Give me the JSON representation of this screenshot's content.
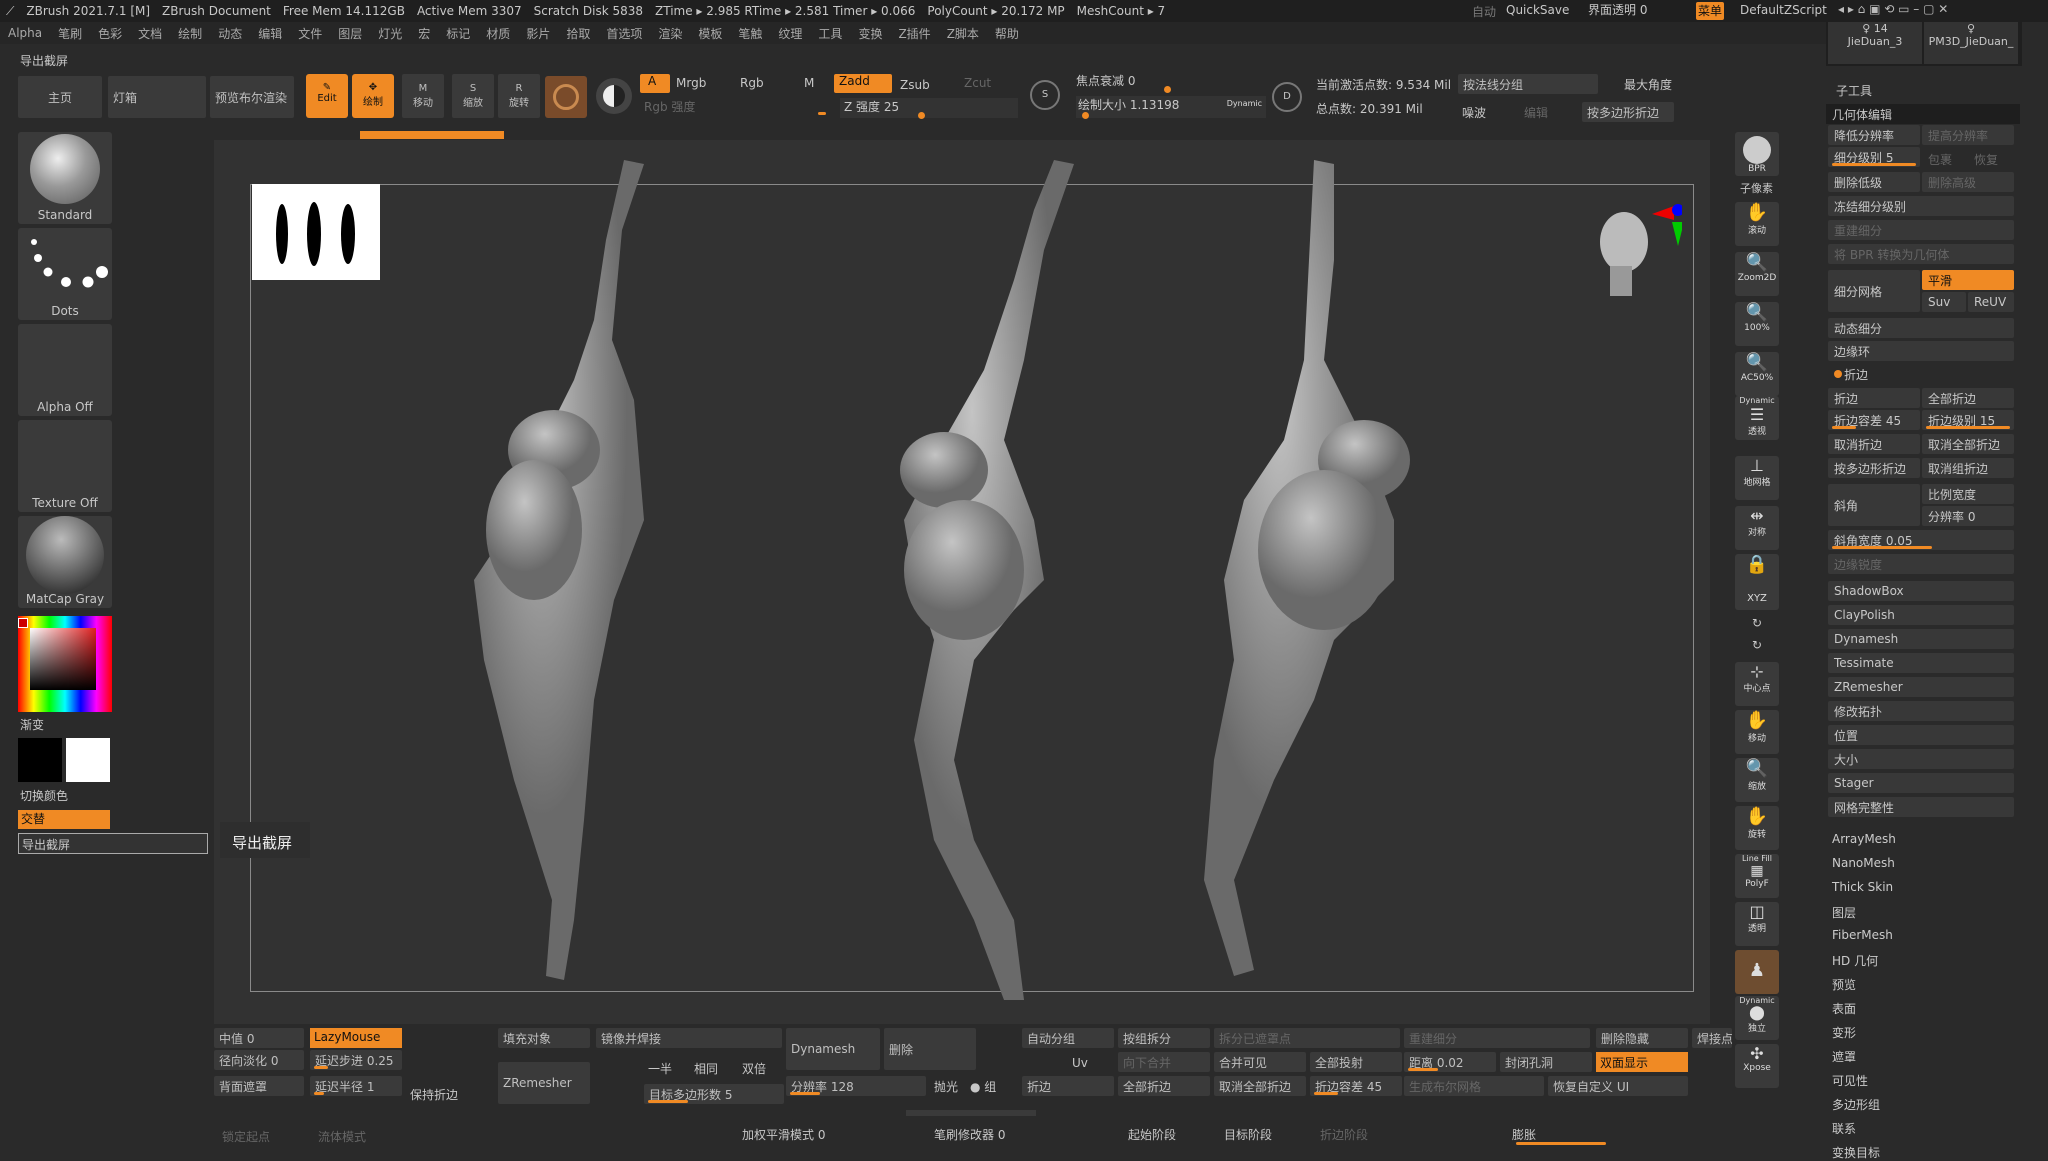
{
  "titlebar": {
    "app": "ZBrush 2021.7.1 [M]",
    "doc": "ZBrush Document",
    "free_mem": "Free Mem 14.112GB",
    "active_mem": "Active Mem 3307",
    "scratch": "Scratch Disk 5838",
    "ztime": "ZTime ▸ 2.985 RTime ▸ 2.581 Timer ▸ 0.066",
    "polycount": "PolyCount ▸ 20.172 MP",
    "meshcount": "MeshCount ▸ 7",
    "auto": "自动",
    "quicksave": "QuickSave",
    "ui_transparency": "界面透明 0",
    "menu_btn": "菜单",
    "script": "DefaultZScript",
    "tool_count": "14"
  },
  "menus": [
    "Alpha",
    "笔刷",
    "色彩",
    "文档",
    "绘制",
    "动态",
    "编辑",
    "文件",
    "图层",
    "灯光",
    "宏",
    "标记",
    "材质",
    "影片",
    "拾取",
    "首选项",
    "渲染",
    "模板",
    "笔触",
    "纹理",
    "工具",
    "变换",
    "Z插件",
    "Z脚本",
    "帮助"
  ],
  "export_label": "导出截屏",
  "top_tabs": {
    "home": "主页",
    "lightbox": "灯箱",
    "bpr": "预览布尔渲染"
  },
  "modes": {
    "edit": "Edit",
    "draw": "绘制",
    "move": "移动",
    "scale": "缩放",
    "rotate": "旋转"
  },
  "colors": {
    "accent": "#f08a24",
    "bg": "#2a2a2a",
    "canvas": "#333333"
  },
  "channels": {
    "a": "A",
    "mrgb": "Mrgb",
    "rgb": "Rgb",
    "m": "M",
    "rgb_intensity": "Rgb 强度",
    "zadd": "Zadd",
    "zsub": "Zsub",
    "zcut": "Zcut",
    "z_intensity": "Z 强度 25"
  },
  "brush_info": {
    "focal": "焦点衰减 0",
    "draw_size": "绘制大小 1.13198",
    "dynamic": "Dynamic",
    "active_points": "当前激活点数: 9.534 Mil",
    "total_points": "总点数: 20.391 Mil",
    "by_normal": "按法线分组",
    "max_angle": "最大角度",
    "noise": "噪波",
    "edit": "编辑",
    "by_poly_crease": "按多边形折边"
  },
  "left": {
    "brush": "Standard",
    "stroke": "Dots",
    "alpha": "Alpha Off",
    "texture": "Texture Off",
    "material": "MatCap Gray",
    "gradient": "渐变",
    "switch_color": "切换颜色",
    "alternate": "交替",
    "export": "导出截屏"
  },
  "canvas": {
    "tooltip": "导出截屏"
  },
  "right_tools": {
    "bpr": "BPR",
    "subpixel": "子像素",
    "scroll": "滚动",
    "zoom2d": "Zoom2D",
    "zoom100": "100%",
    "ac50": "AC50%",
    "persp": "透视",
    "floor": "地网格",
    "sym": "对称",
    "local": "",
    "xyz": "XYZ",
    "center": "中心点",
    "move": "移动",
    "zoom": "缩放",
    "rotate": "旋转",
    "linefill": "Line Fill",
    "polyf": "PolyF",
    "transp": "透明",
    "solo": "独立",
    "xpose": "Xpose"
  },
  "subtools": {
    "a": "JieDuan_3",
    "b": "PM3D_JieDuan_"
  },
  "panel": {
    "subtool": "子工具",
    "geometry": "几何体编辑",
    "lower_res": "降低分辨率",
    "higher_res": "提高分辨率",
    "sdiv": "细分级别 5",
    "cage": "包裹",
    "restore": "恢复",
    "del_lower": "删除低级",
    "del_higher": "删除高级",
    "freeze": "冻结细分级别",
    "reconstruct": "重建细分",
    "bpr_geo": "将 BPR 转换为几何体",
    "divide": "细分网格",
    "smooth": "平滑",
    "suv": "Suv",
    "reuv": "ReUV",
    "dyn_sub": "动态细分",
    "edgeloop": "边缘环",
    "crease": "折边",
    "crease2": "折边",
    "crease_all": "全部折边",
    "crease_tol": "折边容差 45",
    "crease_lvl": "折边级别 15",
    "uncrease": "取消折边",
    "uncrease_all": "取消全部折边",
    "by_poly_crease": "按多边形折边",
    "uncrease_group": "取消组折边",
    "bevel": "斜角",
    "ratio": "比例宽度",
    "res": "分辨率 0",
    "bevel_width": "斜角宽度 0.05",
    "edge_sharp": "边缘锐度",
    "shadowbox": "ShadowBox",
    "claypolish": "ClayPolish",
    "dynamesh": "Dynamesh",
    "tessimate": "Tessimate",
    "zremesher": "ZRemesher",
    "modtopo": "修改拓扑",
    "position": "位置",
    "size": "大小",
    "stager": "Stager",
    "meshintegrity": "网格完整性",
    "list": [
      "ArrayMesh",
      "NanoMesh",
      "Thick Skin",
      "图层",
      "FiberMesh",
      "HD 几何",
      "预览",
      "表面",
      "变形",
      "遮罩",
      "可见性",
      "多边形组",
      "联系",
      "变换目标"
    ]
  },
  "bottom": {
    "mid": "中值 0",
    "lazy": "LazyMouse",
    "radial": "径向淡化 0",
    "lazystep": "延迟步进 0.25",
    "backmask": "背面遮罩",
    "lazyradius": "延迟半径 1",
    "keepcrease": "保持折边",
    "fill": "填充对象",
    "mirrorweld": "镜像并焊接",
    "zrem": "ZRemesher",
    "half": "一半",
    "same": "相同",
    "double": "双倍",
    "target": "目标多边形数 5",
    "dynamesh": "Dynamesh",
    "delete": "删除",
    "res": "分辨率 128",
    "polish": "抛光",
    "group": "● 组",
    "autogroup": "自动分组",
    "bygroupsplit": "按组拆分",
    "splitunmasked": "拆分已遮罩点",
    "uv": "Uv",
    "mergedown": "向下合并",
    "mergevisible": "合并可见",
    "crease": "折边",
    "creaseall": "全部折边",
    "uncreaseall": "取消全部折边",
    "projectall": "全部投射",
    "dist": "距离 0.02",
    "closeholes": "封闭孔洞",
    "rebuild": "重建细分",
    "delhidden": "删除隐藏",
    "weld": "焊接点",
    "doublesided": "双面显示",
    "crease_tol": "折边容差 45",
    "boolmesh": "生成布尔网格",
    "restoreui": "恢复自定义 UI",
    "lockstart": "锁定起点",
    "fluid": "流体模式",
    "weighted": "加权平滑模式 0",
    "modifier": "笔刷修改器 0",
    "startstage": "起始阶段",
    "targetstage": "目标阶段",
    "foldstage": "折边阶段",
    "inflate": "膨胀"
  }
}
